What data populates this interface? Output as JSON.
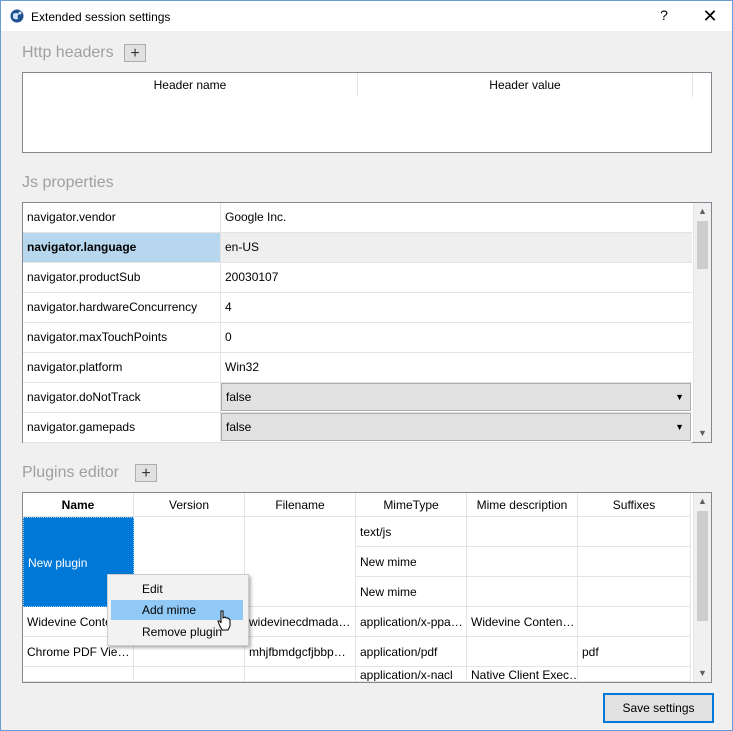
{
  "window": {
    "title": "Extended session settings",
    "help_label": "?",
    "close_label": "✕",
    "icon": "globe-icon"
  },
  "http_headers": {
    "title": "Http headers",
    "add_label": "+",
    "columns": [
      "Header name",
      "Header value"
    ]
  },
  "js_properties": {
    "title": "Js properties",
    "rows": [
      {
        "name": "navigator.vendor",
        "value": "Google Inc."
      },
      {
        "name": "navigator.language",
        "value": "en-US"
      },
      {
        "name": "navigator.productSub",
        "value": "20030107"
      },
      {
        "name": "navigator.hardwareConcurrency",
        "value": "4"
      },
      {
        "name": "navigator.maxTouchPoints",
        "value": "0"
      },
      {
        "name": "navigator.platform",
        "value": "Win32"
      },
      {
        "name": "navigator.doNotTrack",
        "value": "false"
      },
      {
        "name": "navigator.gamepads",
        "value": "false"
      }
    ]
  },
  "plugins": {
    "title": "Plugins editor",
    "add_label": "+",
    "columns": [
      "Name",
      "Version",
      "Filename",
      "MimeType",
      "Mime description",
      "Suffixes"
    ],
    "new_plugin_name": "New plugin",
    "new_plugin_mimes": [
      "text/js",
      "New mime",
      "New mime"
    ],
    "rows": [
      {
        "name": "Widevine Conte…",
        "version": "",
        "filename": "widevinecdmada…",
        "mime": "application/x-ppa…",
        "desc": "Widevine Conten…",
        "suffix": ""
      },
      {
        "name": "Chrome PDF Vie…",
        "version": "",
        "filename": "mhjfbmdgcfjbbp…",
        "mime": "application/pdf",
        "desc": "",
        "suffix": "pdf"
      },
      {
        "name": "",
        "version": "",
        "filename": "",
        "mime": "application/x-nacl",
        "desc": "Native Client Exec…",
        "suffix": ""
      }
    ]
  },
  "context_menu": {
    "items": [
      "Edit",
      "Add mime",
      "Remove plugin"
    ]
  },
  "save_label": "Save settings",
  "colors": {
    "selection": "#0078d7",
    "row_highlight": "#b7d7ef",
    "menu_hover": "#90c8f6"
  }
}
